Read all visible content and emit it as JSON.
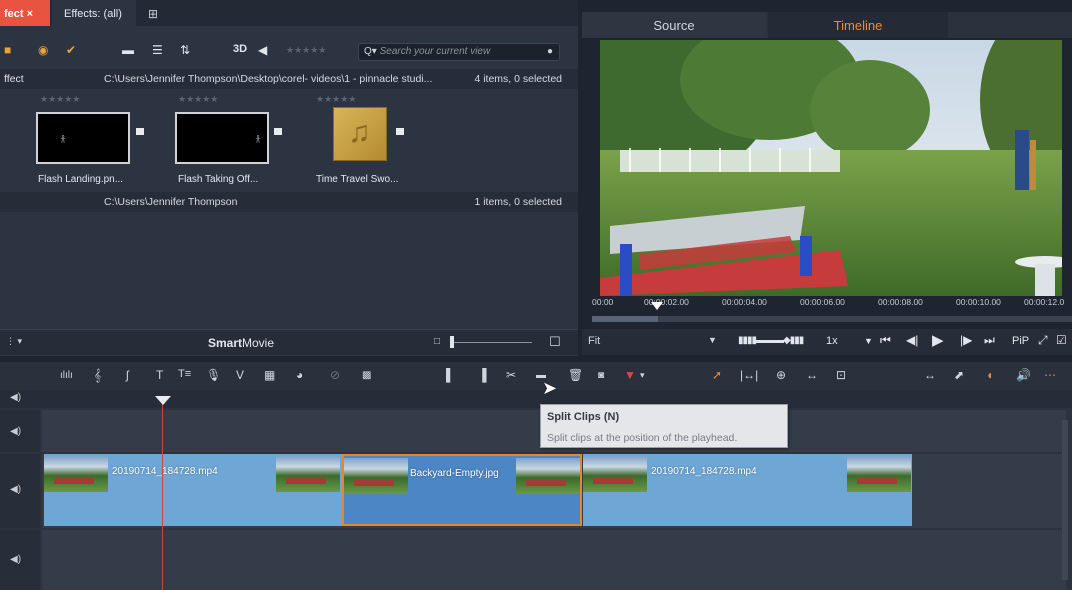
{
  "library": {
    "tabs": [
      {
        "label": "fect ×",
        "active": true
      },
      {
        "label": "Effects: (all)",
        "active": false
      }
    ],
    "view_3d": "3D",
    "search": {
      "placeholder": "Search your current view"
    },
    "section1": {
      "label": "ffect",
      "path": "C:\\Users\\Jennifer Thompson\\Desktop\\corel- videos\\1 - pinnacle studi...",
      "count": "4 items, 0 selected"
    },
    "items": [
      {
        "label": "Flash Landing.pn...",
        "rating": "★★★★★"
      },
      {
        "label": "Flash Taking Off...",
        "rating": "★★★★★"
      },
      {
        "label": "Time Travel Swo...",
        "rating": "★★★★★"
      }
    ],
    "section2": {
      "path": "C:\\Users\\Jennifer Thompson",
      "count": "1 items, 0 selected"
    },
    "smartmovie": {
      "bold": "Smart",
      "rest": "Movie"
    }
  },
  "preview": {
    "tabs": {
      "source": "Source",
      "timeline": "Timeline"
    },
    "ruler": [
      "00:00",
      "00:00:02.00",
      "00:00:04.00",
      "00:00:06.00",
      "00:00:08.00",
      "00:00:10.00",
      "00:00:12.0"
    ],
    "zoom": "Fit",
    "speed": "1x",
    "pip": "PiP"
  },
  "tooltip": {
    "title": "Split Clips (N)",
    "description": "Split clips at the position of the playhead."
  },
  "timeline": {
    "clips": [
      {
        "label": "20190714_184728.mp4"
      },
      {
        "label": "Backyard-Empty.jpg"
      },
      {
        "label": "20190714_184728.mp4"
      }
    ]
  },
  "colors": {
    "accent": "#ef8a33",
    "active_tab": "#e8543f",
    "clip": "#6ea7d6",
    "selected_clip": "#4c86c4",
    "playhead": "#d0453a"
  }
}
